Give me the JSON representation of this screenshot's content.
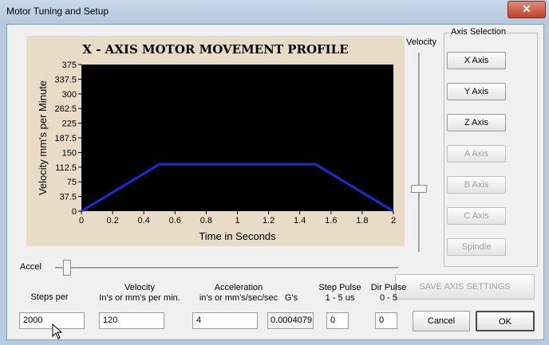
{
  "window": {
    "title": "Motor Tuning and Setup",
    "close_symbol": "✕"
  },
  "chart_data": {
    "type": "line",
    "title": "X - AXIS MOTOR MOVEMENT PROFILE",
    "xlabel": "Time in Seconds",
    "ylabel": "Velocity mm's per Minute",
    "x_ticks": [
      "0",
      "0.2",
      "0.4",
      "0.6",
      "0.8",
      "1",
      "1.2",
      "1.4",
      "1.6",
      "1.8",
      "2"
    ],
    "y_ticks": [
      "0",
      "37.5",
      "75",
      "112.5",
      "150",
      "187.5",
      "225",
      "262.5",
      "300",
      "337.5",
      "375"
    ],
    "xlim": [
      0,
      2
    ],
    "ylim": [
      0,
      375
    ],
    "series": [
      {
        "x": [
          0,
          0.5,
          1.5,
          2
        ],
        "y": [
          0,
          120,
          120,
          0
        ],
        "color": "#1a2dd6"
      }
    ],
    "background": "#000000"
  },
  "velocity_slider": {
    "label": "Velocity",
    "value": 120,
    "max": 375
  },
  "accel_slider": {
    "label": "Accel"
  },
  "axis_selection": {
    "title": "Axis Selection",
    "buttons": [
      {
        "label": "X Axis",
        "enabled": true
      },
      {
        "label": "Y Axis",
        "enabled": true
      },
      {
        "label": "Z Axis",
        "enabled": true
      },
      {
        "label": "A Axis",
        "enabled": false
      },
      {
        "label": "B Axis",
        "enabled": false
      },
      {
        "label": "C Axis",
        "enabled": false
      },
      {
        "label": "Spindle",
        "enabled": false
      }
    ]
  },
  "save_button": "SAVE AXIS SETTINGS",
  "fields": {
    "steps_per": {
      "label": "Steps per",
      "value": "2000"
    },
    "velocity": {
      "label1": "Velocity",
      "label2": "In's or mm's per min.",
      "value": "120"
    },
    "acceleration": {
      "label1": "Acceleration",
      "label2": "in's or mm's/sec/sec",
      "value": "4"
    },
    "gs": {
      "label": "G's",
      "value": "0.0004079"
    },
    "step_pulse": {
      "label1": "Step Pulse",
      "label2": "1 - 5 us",
      "value": "0"
    },
    "dir_pulse": {
      "label1": "Dir Pulse",
      "label2": "0 - 5",
      "value": "0"
    }
  },
  "cancel_button": "Cancel",
  "ok_button": "OK",
  "colors": {
    "line": "#1a2dd6",
    "plot_bg": "#000000",
    "panel_bg": "#e8dcc6"
  }
}
